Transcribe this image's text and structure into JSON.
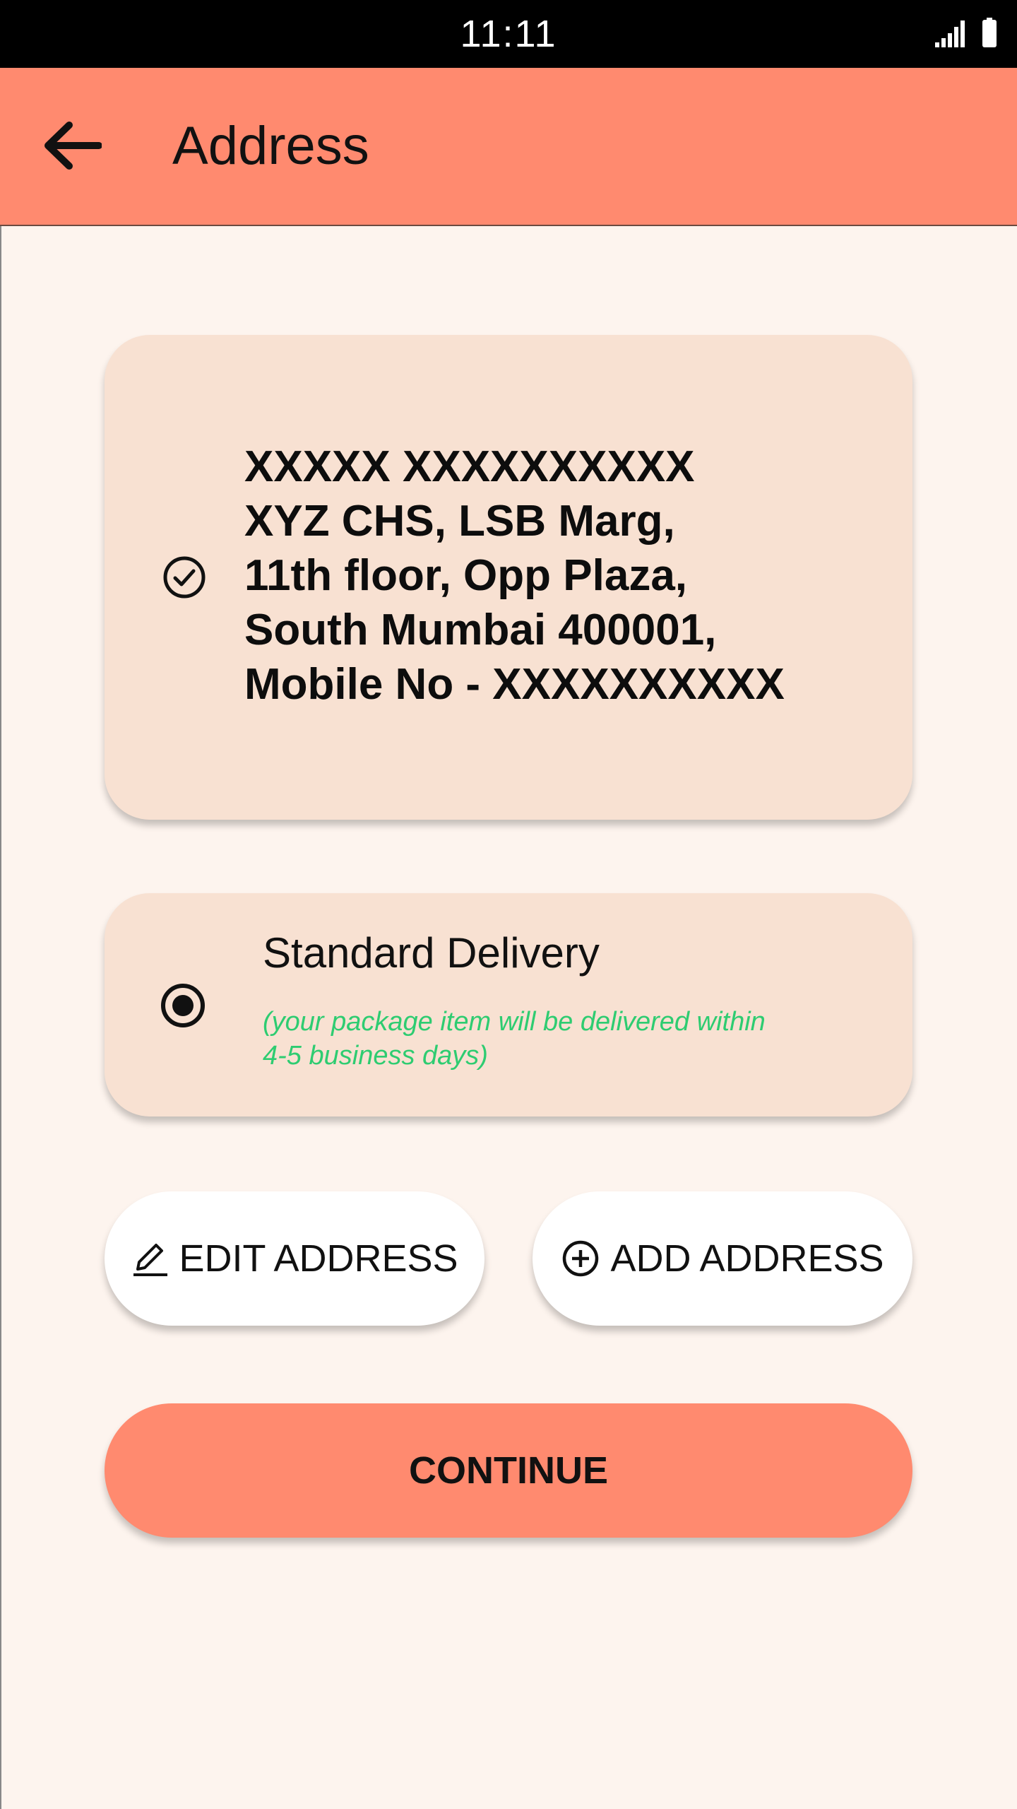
{
  "status_bar": {
    "time": "11:11",
    "icons": [
      "signal-icon",
      "battery-icon"
    ]
  },
  "app_bar": {
    "title": "Address",
    "back_icon": "arrow-back-icon",
    "background": "#FF8A6F"
  },
  "address_card": {
    "selected_icon": "check-circle-icon",
    "lines": [
      "XXXXX XXXXXXXXXX",
      "XYZ CHS, LSB Marg,",
      "11th floor, Opp Plaza,",
      "South Mumbai 400001,",
      "Mobile No - XXXXXXXXXX"
    ]
  },
  "delivery_option": {
    "title": "Standard Delivery",
    "note": "(your package item will be delivered within 4-5 business days)",
    "selected": true,
    "radio_icon": "radio-selected-icon",
    "note_color": "#2ecc71"
  },
  "actions": {
    "edit_label": "EDIT ADDRESS",
    "edit_icon": "pencil-icon",
    "add_label": "ADD ADDRESS",
    "add_icon": "plus-circle-icon",
    "continue_label": "CONTINUE"
  },
  "colors": {
    "accent": "#FF8A6F",
    "card_background": "#F8E1D2",
    "page_background": "#FDF4EE"
  }
}
